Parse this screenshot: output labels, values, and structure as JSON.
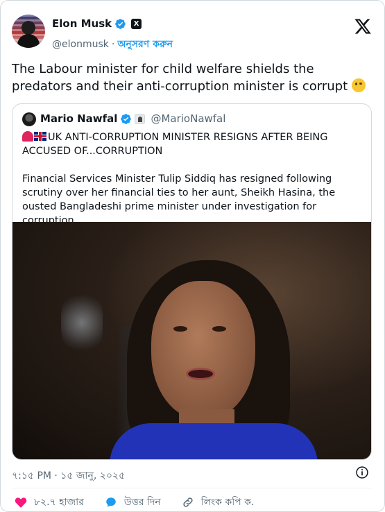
{
  "author": {
    "display_name": "Elon Musk",
    "handle": "@elonmusk",
    "separator": "·",
    "follow_label": "অনুসরণ করুন",
    "badge": "X"
  },
  "tweet": {
    "text": "The Labour minister for child welfare shields the predators and their anti-corruption minister is corrupt",
    "emoji": "face-with-raised-eyebrow"
  },
  "quote": {
    "display_name": "Mario Nawfal",
    "handle": "@MarioNawfal",
    "headline": "UK ANTI-CORRUPTION MINISTER RESIGNS AFTER BEING ACCUSED OF...CORRUPTION",
    "body": "Financial Services Minister Tulip Siddiq has resigned following scrutiny over her financial ties to her aunt, Sheikh Hasina, the ousted Bangladeshi prime minister under investigation for corruption...."
  },
  "meta": {
    "timestamp": "৭:১৫ PM · ১৫ জানু, ২০২৫"
  },
  "actions": {
    "likes_label": "৮২.৭ হাজার",
    "reply_label": "উত্তর দিন",
    "copy_link_label": "লিংক কপি ক."
  },
  "colors": {
    "accent": "#1d9bf0",
    "like": "#f91880",
    "text_secondary": "#536471",
    "border": "#cfd9de"
  }
}
